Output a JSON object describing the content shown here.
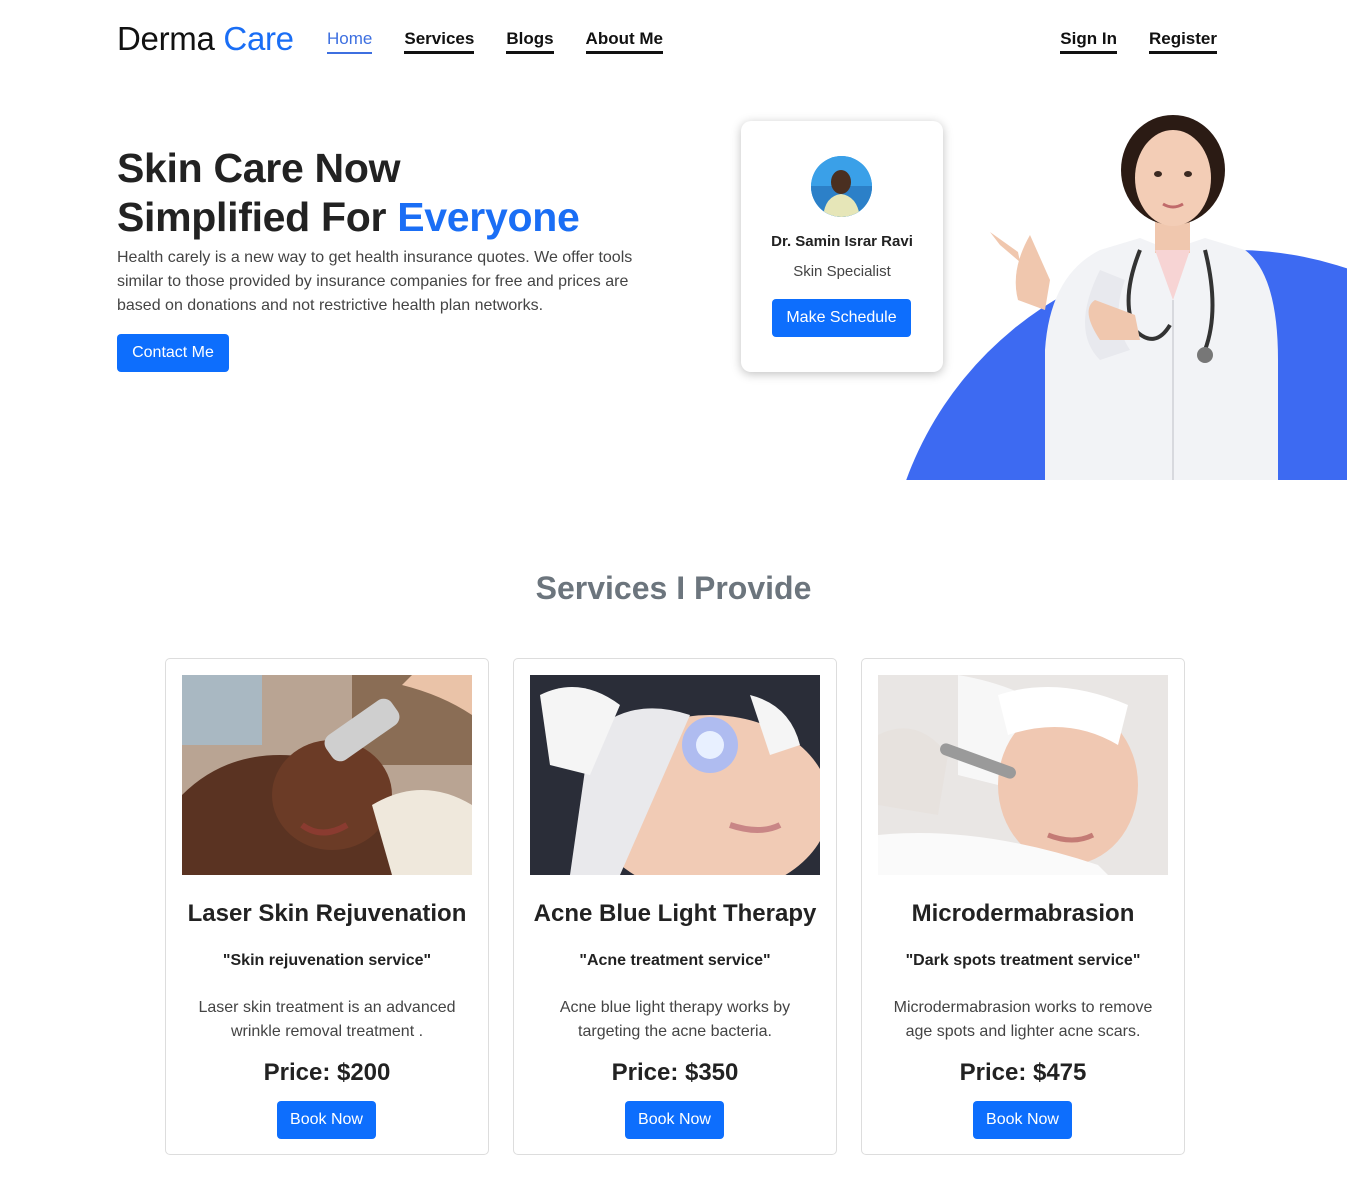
{
  "brand": {
    "part1": "Derma",
    "part2": "Care"
  },
  "nav": {
    "links": [
      "Home",
      "Services",
      "Blogs",
      "About Me"
    ],
    "auth": [
      "Sign In",
      "Register"
    ]
  },
  "hero": {
    "title_line1": "Skin Care Now",
    "title_line2a": "Simplified For",
    "title_line2b": "Everyone",
    "text": "Health carely is a new way to get health insurance quotes. We offer tools similar to those provided by insurance companies for free and prices are based on donations and not restrictive health plan networks.",
    "cta": "Contact Me"
  },
  "doctor_card": {
    "name": "Dr. Samin Israr Ravi",
    "role": "Skin Specialist",
    "cta": "Make Schedule"
  },
  "services": {
    "title": "Services I Provide",
    "items": [
      {
        "title": "Laser Skin Rejuvenation",
        "subtitle": "\"Skin rejuvenation service\"",
        "desc": "Laser skin treatment is an advanced wrinkle removal treatment .",
        "price": "Price: $200",
        "cta": "Book Now"
      },
      {
        "title": "Acne Blue Light Therapy",
        "subtitle": "\"Acne treatment service\"",
        "desc": "Acne blue light therapy works by targeting the acne bacteria.",
        "price": "Price: $350",
        "cta": "Book Now"
      },
      {
        "title": "Microdermabrasion",
        "subtitle": "\"Dark spots treatment service\"",
        "desc": "Microdermabrasion works to remove age spots and lighter acne scars.",
        "price": "Price: $475",
        "cta": "Book Now"
      }
    ]
  },
  "colors": {
    "accent": "#1a6ef5",
    "button": "#0d6efd",
    "arc": "#3d6af2"
  }
}
